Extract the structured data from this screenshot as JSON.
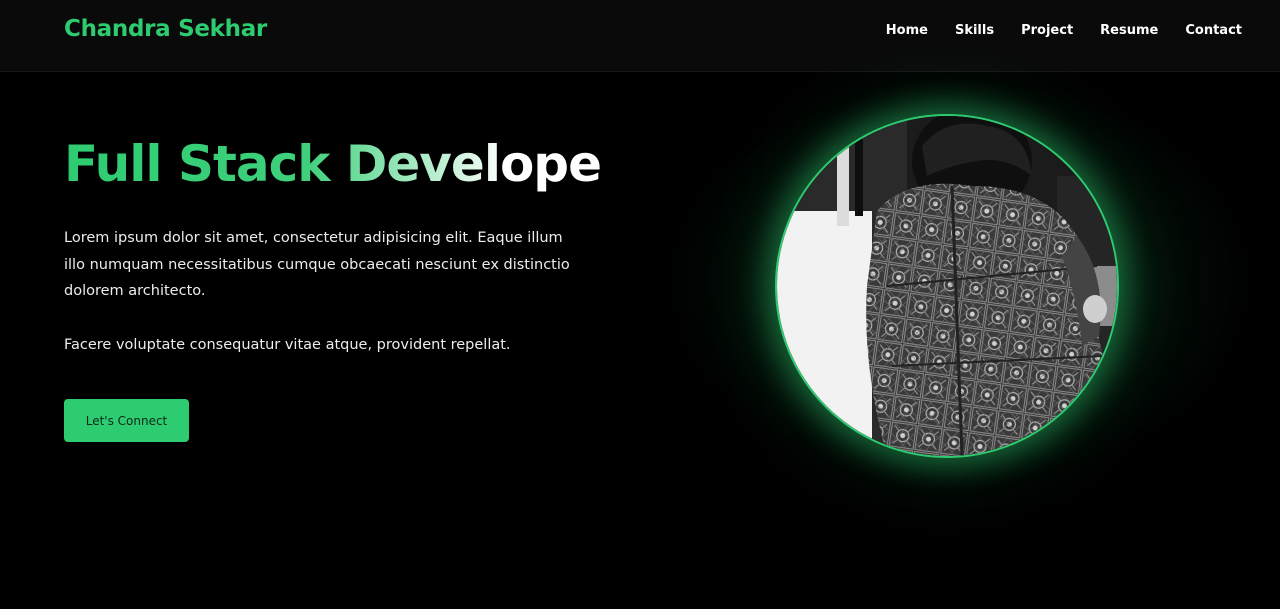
{
  "brand": {
    "name": "Chandra Sekhar",
    "color": "#2ecc71"
  },
  "nav": {
    "items": [
      {
        "label": "Home"
      },
      {
        "label": "Skills"
      },
      {
        "label": "Project"
      },
      {
        "label": "Resume"
      },
      {
        "label": "Contact"
      }
    ]
  },
  "hero": {
    "title": "Full Stack Developer",
    "description": "Lorem ipsum dolor sit amet, consectetur adipisicing elit. Eaque illum illo numquam necessitatibus cumque obcaecati nesciunt ex distinctio dolorem architecto.",
    "note": "Facere voluptate consequatur vitae atque, provident repellat.",
    "cta_label": "Let's Connect"
  },
  "profile_image": {
    "alt": ""
  },
  "colors": {
    "background": "#000000",
    "navbar": "#0a0a0a",
    "accent": "#2ecc71",
    "text": "#ececec"
  }
}
